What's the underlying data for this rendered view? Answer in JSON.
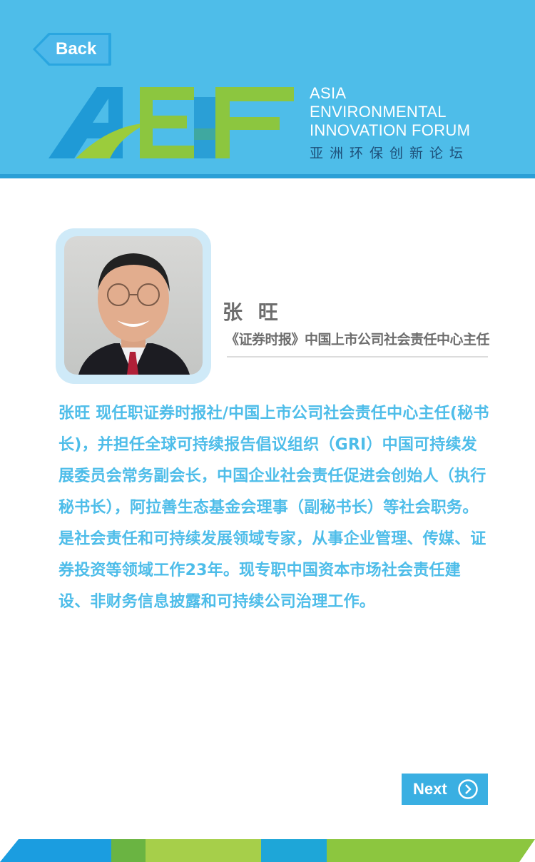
{
  "nav": {
    "back_label": "Back",
    "next_label": "Next"
  },
  "logo": {
    "lines": [
      "ASIA",
      "ENVIRONMENTAL",
      "INNOVATION FORUM"
    ],
    "cn": "亚洲环保创新论坛"
  },
  "speaker": {
    "name": "张 旺",
    "title": "《证券时报》中国上市公司社会责任中心主任",
    "bio": "张旺 现任职证券时报社/中国上市公司社会责任中心主任(秘书长)，并担任全球可持续报告倡议组织（GRI）中国可持续发展委员会常务副会长，中国企业社会责任促进会创始人（执行秘书长），阿拉善生态基金会理事（副秘书长）等社会职务。是社会责任和可持续发展领域专家，从事企业管理、传媒、证券投资等领域工作23年。现专职中国资本市场社会责任建设、非财务信息披露和可持续公司治理工作。"
  },
  "colors": {
    "header": "#4ebde9",
    "header_line": "#2a9fd6",
    "bio_text": "#4ebde9",
    "name_text": "#6d6d6d",
    "button": "#3aafe2"
  },
  "icons": [
    "back-arrow-icon",
    "chevron-right-circle-icon"
  ]
}
